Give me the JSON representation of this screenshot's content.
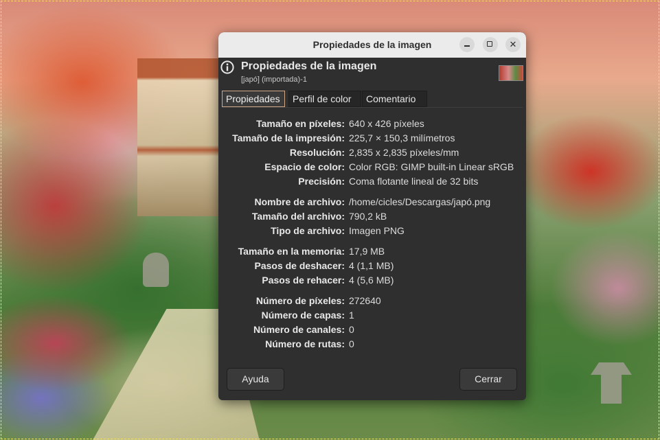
{
  "dialog": {
    "window_title": "Propiedades de la imagen",
    "heading": "Propiedades de la imagen",
    "subheading": "[japó] (importada)-1",
    "tabs": [
      {
        "label": "Propiedades",
        "active": true
      },
      {
        "label": "Perfil de color",
        "active": false
      },
      {
        "label": "Comentario",
        "active": false
      }
    ],
    "properties": [
      {
        "label": "Tamaño en píxeles:",
        "value": "640 x 426 píxeles"
      },
      {
        "label": "Tamaño de la impresión:",
        "value": "225,7 × 150,3 milímetros"
      },
      {
        "label": "Resolución:",
        "value": "2,835 x 2,835 píxeles/mm"
      },
      {
        "label": "Espacio de color:",
        "value": "Color RGB: GIMP built-in Linear sRGB"
      },
      {
        "label": "Precisión:",
        "value": "Coma flotante lineal de 32 bits"
      },
      {
        "label": "Nombre de archivo:",
        "value": "/home/cicles/Descargas/japó.png"
      },
      {
        "label": "Tamaño del archivo:",
        "value": "790,2 kB"
      },
      {
        "label": "Tipo de archivo:",
        "value": "Imagen PNG"
      },
      {
        "label": "Tamaño en la memoria:",
        "value": "17,9 MB"
      },
      {
        "label": "Pasos de deshacer:",
        "value": "4 (1,1 MB)"
      },
      {
        "label": "Pasos de rehacer:",
        "value": "4 (5,6 MB)"
      },
      {
        "label": "Número de píxeles:",
        "value": "272640"
      },
      {
        "label": "Número de capas:",
        "value": "1"
      },
      {
        "label": "Número de canales:",
        "value": "0"
      },
      {
        "label": "Número de rutas:",
        "value": "0"
      }
    ],
    "buttons": {
      "help": "Ayuda",
      "close": "Cerrar"
    },
    "window_controls": {
      "minimize_icon": "minimize-icon",
      "maximize_icon": "maximize-icon",
      "close_icon": "close-icon",
      "close_glyph": "✕"
    }
  },
  "colors": {
    "dialog_bg": "#2f2f2f",
    "titlebar_bg": "#ebebeb",
    "active_tab_border": "#cfa88a",
    "selection_outline": "#f4e24a"
  }
}
